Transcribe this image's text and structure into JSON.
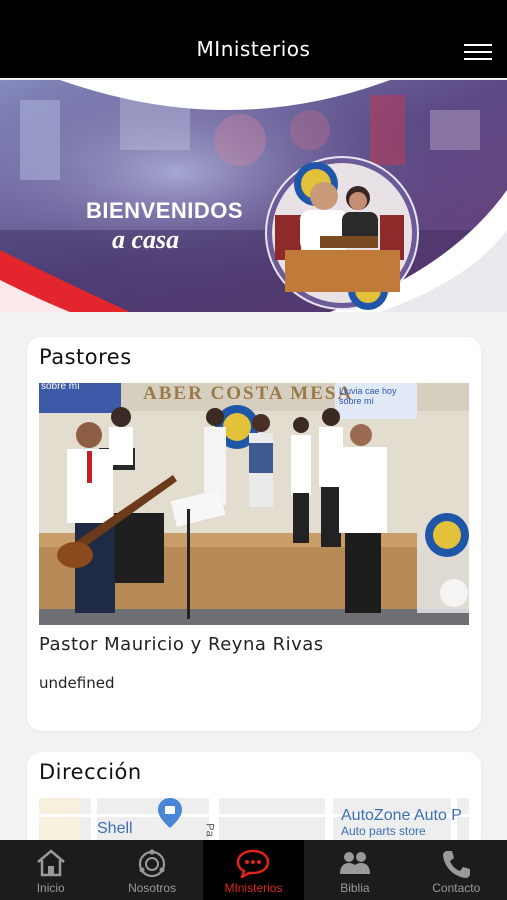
{
  "header": {
    "title": "MInisterios",
    "menu_icon": "hamburger-menu-icon"
  },
  "banner": {
    "title": "BIENVENIDOS",
    "subtitle": "a casa"
  },
  "pastores": {
    "heading": "Pastores",
    "photo_signs": [
      "sobre mí",
      "ABER COSTA MESA",
      "Lluvia cae hoy sobre mí"
    ],
    "name": "Pastor Mauricio y Reyna Rivas",
    "description": "undefined"
  },
  "direccion": {
    "heading": "Dirección",
    "map_labels": {
      "shell": "Shell",
      "street": "Pa",
      "autozone": "AutoZone Auto P",
      "autozone_sub": "Auto parts store"
    }
  },
  "tabs": [
    {
      "label": "Inicio",
      "icon": "home-icon"
    },
    {
      "label": "Nosotros",
      "icon": "nosotros-icon"
    },
    {
      "label": "MInisterios",
      "icon": "chat-icon",
      "active": true
    },
    {
      "label": "Biblia",
      "icon": "people-icon"
    },
    {
      "label": "Contacto",
      "icon": "phone-icon"
    }
  ],
  "colors": {
    "header_bg": "#000000",
    "accent": "#e0241a",
    "tabbar_bg": "#1c1c1c"
  }
}
